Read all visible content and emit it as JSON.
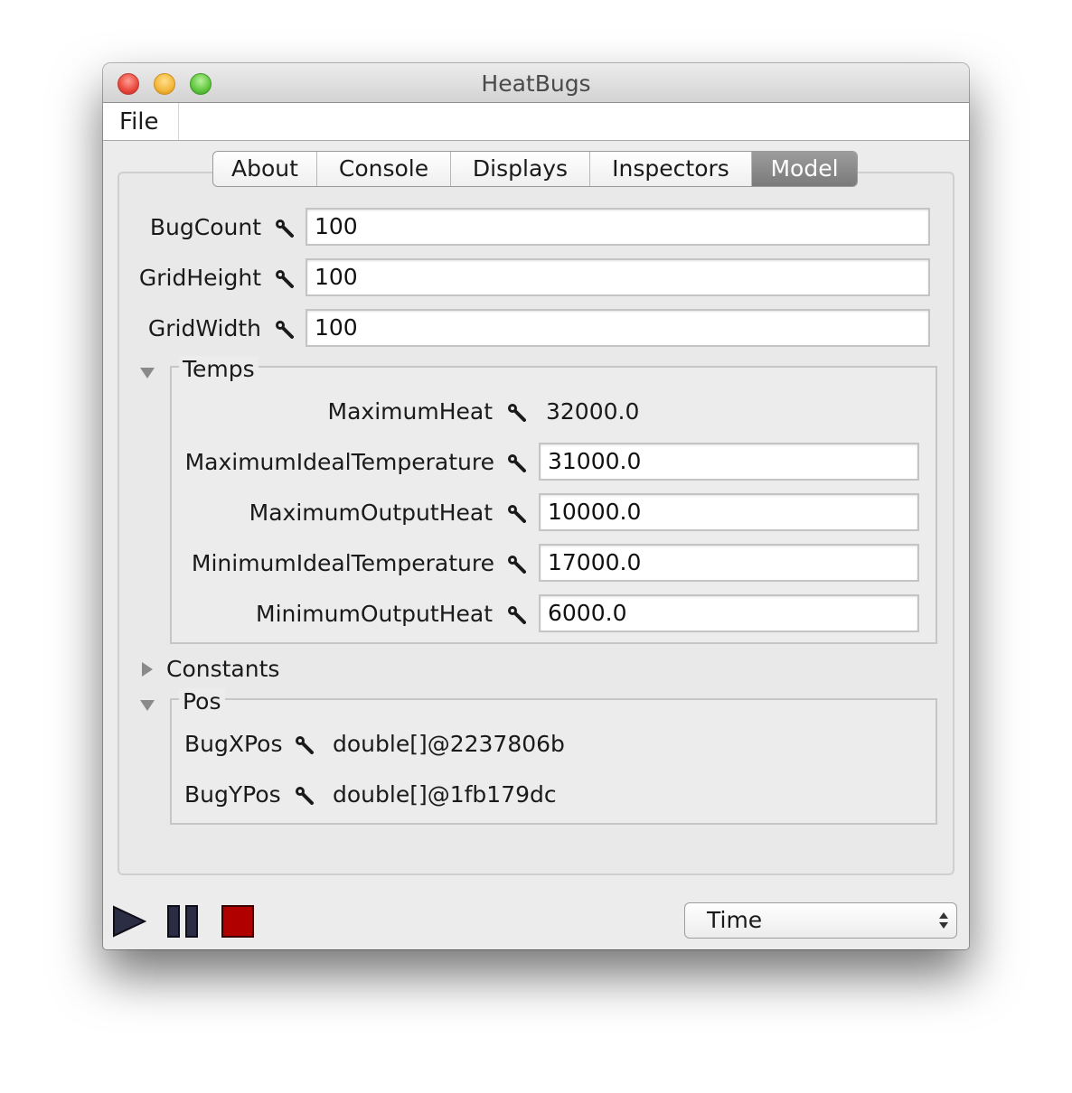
{
  "window": {
    "title": "HeatBugs"
  },
  "menu": {
    "file": "File"
  },
  "tabs": [
    {
      "label": "About",
      "active": false
    },
    {
      "label": "Console",
      "active": false
    },
    {
      "label": "Displays",
      "active": false
    },
    {
      "label": "Inspectors",
      "active": false
    },
    {
      "label": "Model",
      "active": true
    }
  ],
  "model": {
    "bug_count": {
      "label": "BugCount",
      "value": "100"
    },
    "grid_height": {
      "label": "GridHeight",
      "value": "100"
    },
    "grid_width": {
      "label": "GridWidth",
      "value": "100"
    }
  },
  "temps": {
    "title": "Temps",
    "maximum_heat": {
      "label": "MaximumHeat",
      "value": "32000.0"
    },
    "maximum_ideal_temperature": {
      "label": "MaximumIdealTemperature",
      "value": "31000.0"
    },
    "maximum_output_heat": {
      "label": "MaximumOutputHeat",
      "value": "10000.0"
    },
    "minimum_ideal_temperature": {
      "label": "MinimumIdealTemperature",
      "value": "17000.0"
    },
    "minimum_output_heat": {
      "label": "MinimumOutputHeat",
      "value": "6000.0"
    }
  },
  "constants": {
    "title": "Constants"
  },
  "pos": {
    "title": "Pos",
    "bug_x_pos": {
      "label": "BugXPos",
      "value": "double[]@2237806b"
    },
    "bug_y_pos": {
      "label": "BugYPos",
      "value": "double[]@1fb179dc"
    }
  },
  "controls": {
    "time_select": "Time"
  },
  "colors": {
    "accent_tab": "#8a8a8a",
    "stop": "#b00000",
    "play": "#2a2a3a"
  },
  "icons": [
    "wrench-icon",
    "play-icon",
    "pause-icon",
    "stop-icon",
    "disclosure-triangle-icon",
    "select-arrows-icon"
  ]
}
